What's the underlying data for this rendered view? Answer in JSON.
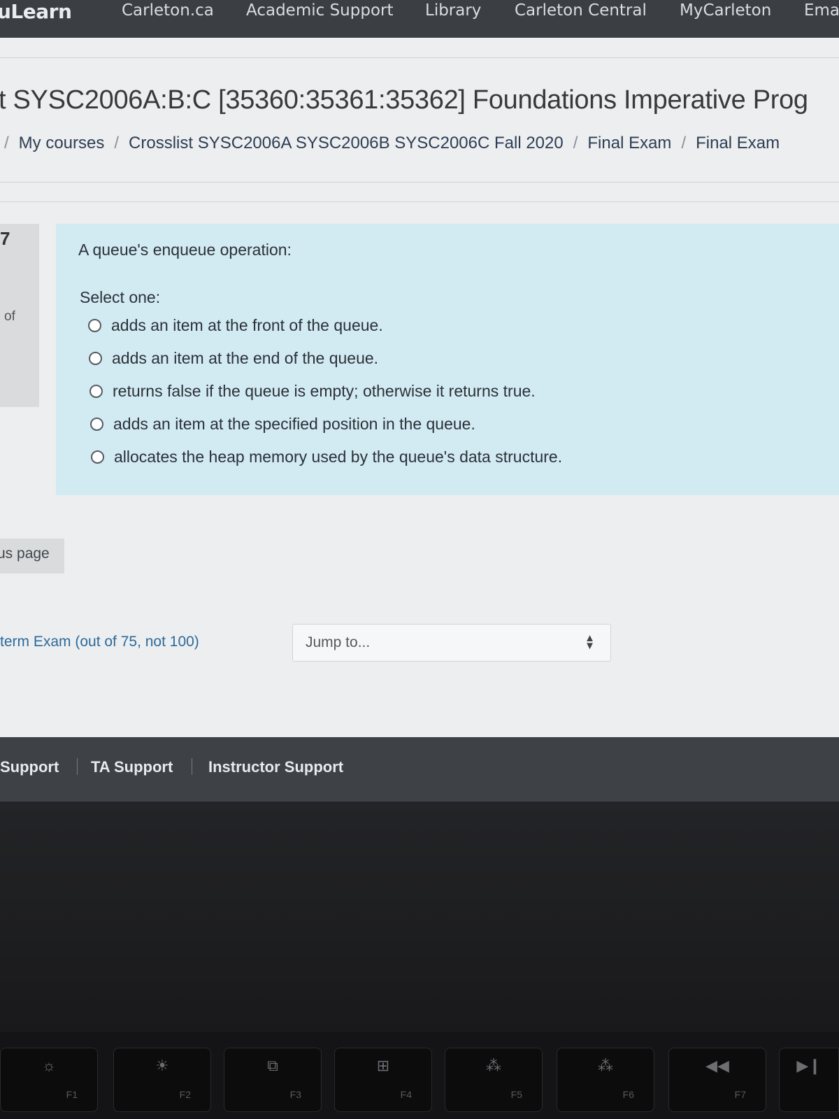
{
  "navbar": {
    "brand": "uLearn",
    "links": [
      "Carleton.ca",
      "Academic Support",
      "Library",
      "Carleton Central",
      "MyCarleton",
      "Ema"
    ]
  },
  "page": {
    "title": "t SYSC2006A:B:C [35360:35361:35362] Foundations Imperative Prog",
    "breadcrumb": [
      "My courses",
      "Crosslist SYSC2006A SYSC2006B SYSC2006C Fall 2020",
      "Final Exam",
      "Final Exam"
    ]
  },
  "question": {
    "number": "7",
    "info_fragment": "of",
    "text": "A queue's enqueue operation:",
    "prompt": "Select one:",
    "options": [
      "adds an item at the front of the queue.",
      "adds an item at the end of the queue.",
      "returns false if the queue is empty; otherwise it returns true.",
      "adds an item at the specified position in the queue.",
      "allocates the heap memory used by the queue's data structure."
    ],
    "selected": null
  },
  "navigation": {
    "prev_page_label": "us page",
    "activity_link": "term Exam (out of 75, not 100)",
    "jump_placeholder": "Jump to..."
  },
  "footer": {
    "links": [
      "Support",
      "TA Support",
      "Instructor Support"
    ]
  },
  "keyboard": {
    "keys": [
      {
        "fn": "F1",
        "icon": "brightness-down-icon",
        "glyph": "☼"
      },
      {
        "fn": "F2",
        "icon": "brightness-up-icon",
        "glyph": "☀"
      },
      {
        "fn": "F3",
        "icon": "mission-control-icon",
        "glyph": "⧉"
      },
      {
        "fn": "F4",
        "icon": "launchpad-icon",
        "glyph": "⊞"
      },
      {
        "fn": "F5",
        "icon": "keyboard-light-down-icon",
        "glyph": "⁂"
      },
      {
        "fn": "F6",
        "icon": "keyboard-light-up-icon",
        "glyph": "⁂"
      },
      {
        "fn": "F7",
        "icon": "rewind-icon",
        "glyph": "◀◀"
      },
      {
        "fn": "",
        "icon": "play-pause-icon",
        "glyph": "▶❙"
      }
    ]
  }
}
